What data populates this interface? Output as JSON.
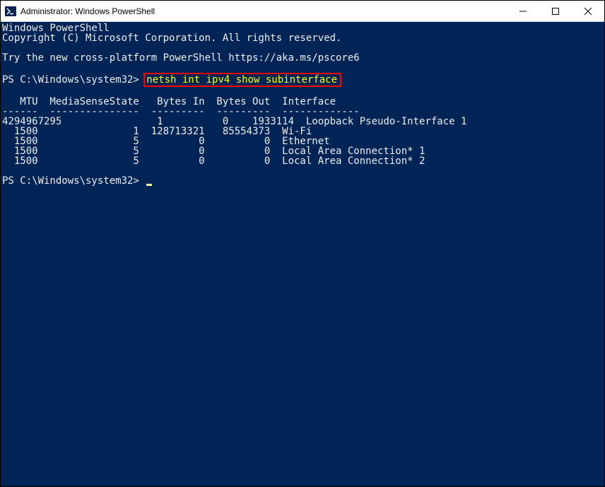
{
  "window": {
    "title": "Administrator: Windows PowerShell"
  },
  "terminal": {
    "header1": "Windows PowerShell",
    "header2": "Copyright (C) Microsoft Corporation. All rights reserved.",
    "tip": "Try the new cross-platform PowerShell https://aka.ms/pscore6",
    "prompt1_prefix": "PS C:\\Windows\\system32> ",
    "command1": "netsh int ipv4 show subinterface",
    "table_header": "   MTU  MediaSenseState   Bytes In  Bytes Out  Interface",
    "table_divider": "------  ---------------  ---------  ---------  -------------",
    "rows": [
      "4294967295                1          0    1933114  Loopback Pseudo-Interface 1",
      "  1500                1  128713321   85554373  Wi-Fi",
      "  1500                5          0          0  Ethernet",
      "  1500                5          0          0  Local Area Connection* 1",
      "  1500                5          0          0  Local Area Connection* 2"
    ],
    "prompt2_prefix": "PS C:\\Windows\\system32> "
  }
}
